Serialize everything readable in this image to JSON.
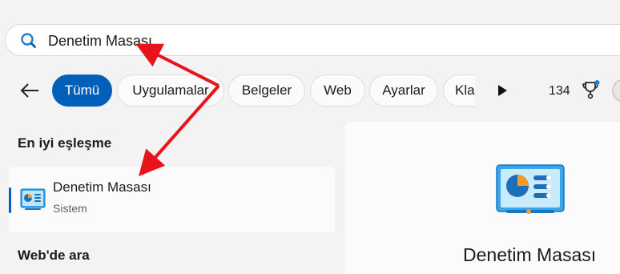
{
  "search": {
    "query": "Denetim Masası"
  },
  "filters": {
    "tabs": [
      {
        "label": "Tümü",
        "active": true
      },
      {
        "label": "Uygulamalar",
        "active": false
      },
      {
        "label": "Belgeler",
        "active": false
      },
      {
        "label": "Web",
        "active": false
      },
      {
        "label": "Ayarlar",
        "active": false
      },
      {
        "label": "Kla",
        "active": false
      }
    ],
    "points_count": "134"
  },
  "best_match": {
    "heading": "En iyi eşleşme",
    "title": "Denetim Masası",
    "subtitle": "Sistem"
  },
  "web_search": {
    "heading": "Web'de ara"
  },
  "preview": {
    "title": "Denetim Masası"
  },
  "icons": {
    "search": "search-icon",
    "back": "back-arrow-icon",
    "more": "play-icon",
    "rewards": "trophy-icon",
    "app": "control-panel-icon"
  },
  "colors": {
    "accent": "#005fb8",
    "annotation_arrow": "#e8141b",
    "background": "#f3f3f3"
  }
}
